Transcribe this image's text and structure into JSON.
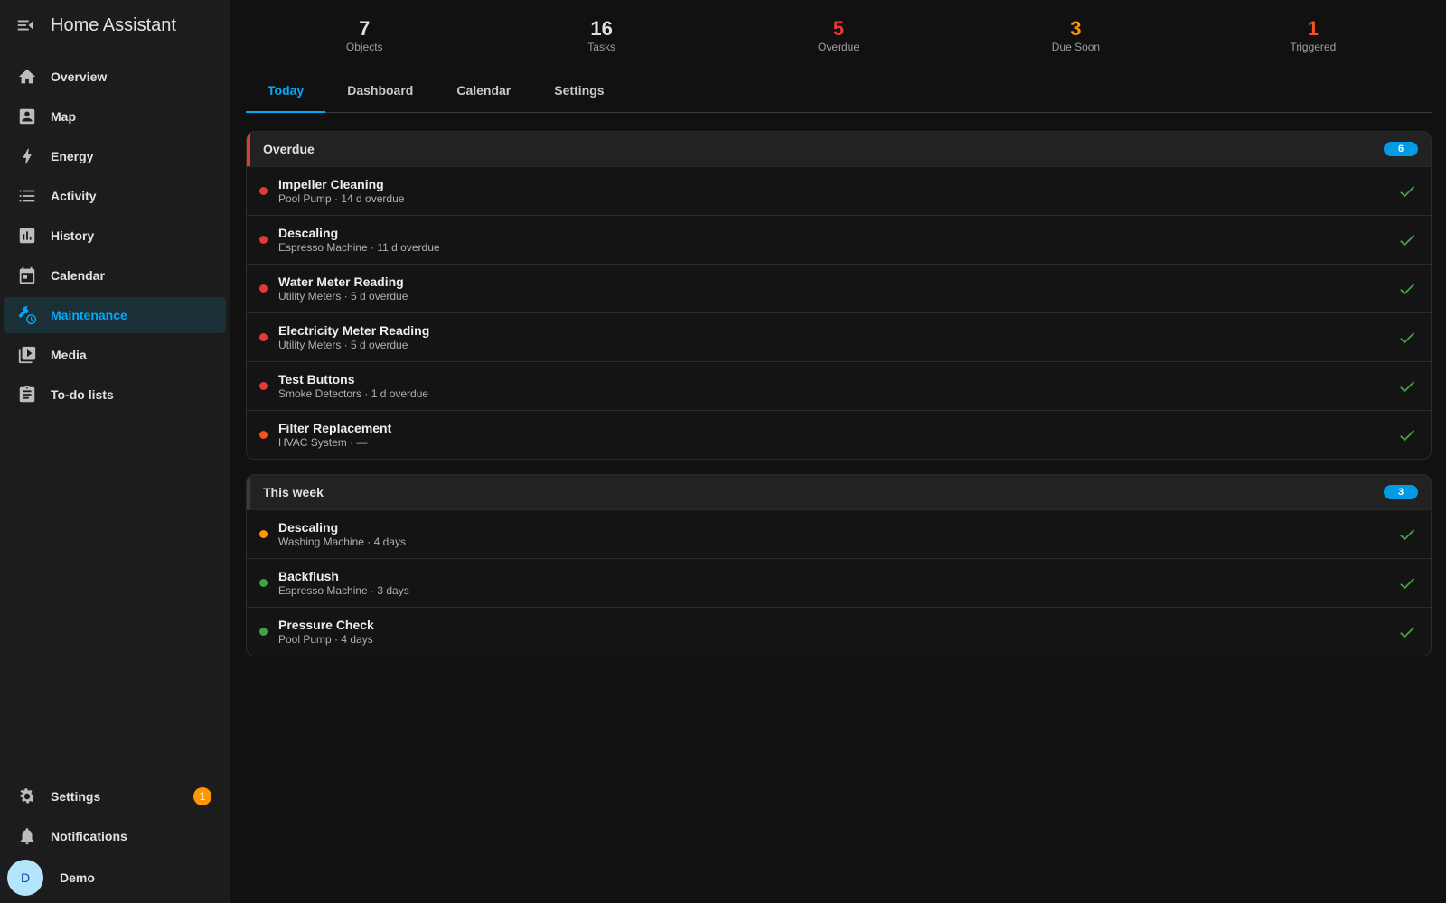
{
  "app": {
    "title": "Home Assistant"
  },
  "sidebar": {
    "items": [
      {
        "label": "Overview",
        "icon": "home-icon",
        "active": false
      },
      {
        "label": "Map",
        "icon": "map-icon",
        "active": false
      },
      {
        "label": "Energy",
        "icon": "lightning-icon",
        "active": false
      },
      {
        "label": "Activity",
        "icon": "list-icon",
        "active": false
      },
      {
        "label": "History",
        "icon": "chart-box-icon",
        "active": false
      },
      {
        "label": "Calendar",
        "icon": "calendar-icon",
        "active": false
      },
      {
        "label": "Maintenance",
        "icon": "wrench-clock-icon",
        "active": true
      },
      {
        "label": "Media",
        "icon": "play-box-icon",
        "active": false
      },
      {
        "label": "To-do lists",
        "icon": "clipboard-list-icon",
        "active": false
      }
    ],
    "settings": {
      "label": "Settings",
      "badge": "1"
    },
    "notifications": {
      "label": "Notifications"
    },
    "user": {
      "initial": "D",
      "name": "Demo"
    }
  },
  "stats": [
    {
      "value": "7",
      "label": "Objects",
      "color": "#e1e1e1"
    },
    {
      "value": "16",
      "label": "Tasks",
      "color": "#e1e1e1"
    },
    {
      "value": "5",
      "label": "Overdue",
      "color": "#e53935"
    },
    {
      "value": "3",
      "label": "Due Soon",
      "color": "#ff9800"
    },
    {
      "value": "1",
      "label": "Triggered",
      "color": "#f4511e"
    }
  ],
  "tabs": [
    {
      "label": "Today",
      "active": true
    },
    {
      "label": "Dashboard",
      "active": false
    },
    {
      "label": "Calendar",
      "active": false
    },
    {
      "label": "Settings",
      "active": false
    }
  ],
  "groups": [
    {
      "title": "Overdue",
      "count": "6",
      "bar_color": "#e53935",
      "tasks": [
        {
          "title": "Impeller Cleaning",
          "subtitle": "Pool Pump · 14 d overdue",
          "dot": "#e53935"
        },
        {
          "title": "Descaling",
          "subtitle": "Espresso Machine · 11 d overdue",
          "dot": "#e53935"
        },
        {
          "title": "Water Meter Reading",
          "subtitle": "Utility Meters · 5 d overdue",
          "dot": "#e53935"
        },
        {
          "title": "Electricity Meter Reading",
          "subtitle": "Utility Meters · 5 d overdue",
          "dot": "#e53935"
        },
        {
          "title": "Test Buttons",
          "subtitle": "Smoke Detectors · 1 d overdue",
          "dot": "#e53935"
        },
        {
          "title": "Filter Replacement",
          "subtitle": "HVAC System · —",
          "dot": "#f4511e"
        }
      ]
    },
    {
      "title": "This week",
      "count": "3",
      "bar_color": "#3a3a3a",
      "tasks": [
        {
          "title": "Descaling",
          "subtitle": "Washing Machine · 4 days",
          "dot": "#ff9800"
        },
        {
          "title": "Backflush",
          "subtitle": "Espresso Machine · 3 days",
          "dot": "#43a047"
        },
        {
          "title": "Pressure Check",
          "subtitle": "Pool Pump · 4 days",
          "dot": "#43a047"
        }
      ]
    }
  ],
  "colors": {
    "accent": "#03a9f4",
    "check": "#43a047"
  }
}
